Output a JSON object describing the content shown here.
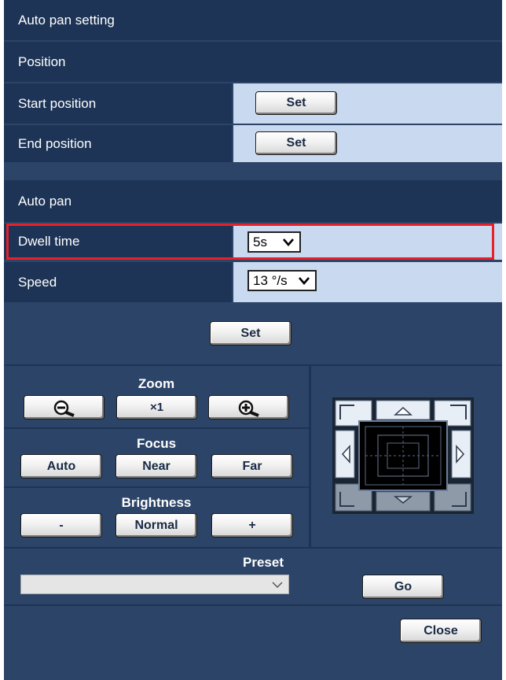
{
  "panel": {
    "title": "Auto pan setting",
    "position_header": "Position",
    "start_position_label": "Start position",
    "end_position_label": "End position",
    "set_label": "Set",
    "auto_pan_header": "Auto pan",
    "dwell_time_label": "Dwell time",
    "dwell_time_value": "5s",
    "speed_label": "Speed",
    "speed_value": "13 °/s",
    "apply_set_label": "Set"
  },
  "controls": {
    "zoom_title": "Zoom",
    "zoom_x1_label": "×1",
    "focus_title": "Focus",
    "focus_auto_label": "Auto",
    "focus_near_label": "Near",
    "focus_far_label": "Far",
    "brightness_title": "Brightness",
    "brightness_minus_label": "-",
    "brightness_normal_label": "Normal",
    "brightness_plus_label": "+"
  },
  "preset": {
    "title": "Preset",
    "selected_value": "",
    "go_label": "Go"
  },
  "footer": {
    "close_label": "Close"
  },
  "colors": {
    "panel_background": "#2c4467",
    "header_background": "#1d3456",
    "value_cell_background": "#c9d9ef",
    "highlight_border": "#e8202a"
  },
  "icons": {
    "zoom_out": "zoom-out-icon",
    "zoom_in": "zoom-in-icon",
    "dropdown": "chevron-down-icon",
    "pan_tilt_pad": "pan-tilt-pad"
  }
}
